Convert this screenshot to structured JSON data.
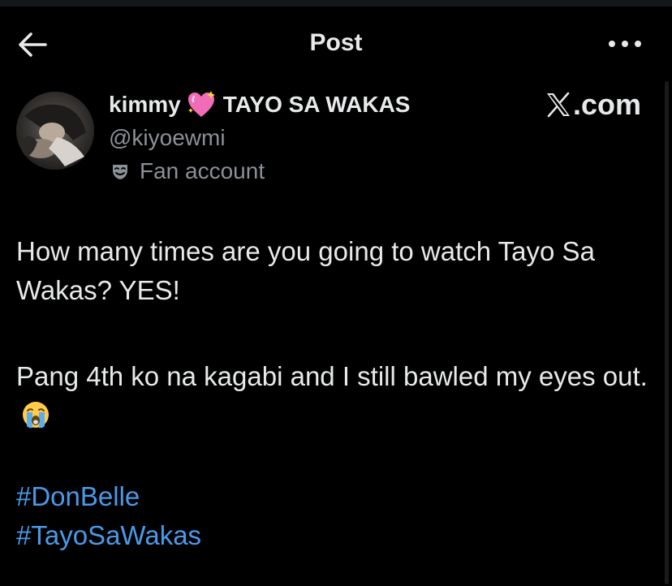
{
  "header": {
    "title": "Post",
    "back_icon": "arrow-left-icon",
    "more_icon": "more-horizontal-icon"
  },
  "author": {
    "name": "kimmy",
    "name_emoji": "sparkling-heart-emoji",
    "name_suffix": "TAYO SA WAKAS",
    "handle": "@kiyoewmi",
    "label": "Fan account",
    "label_icon": "mask-icon"
  },
  "watermark": {
    "text": ".com",
    "logo": "x-logo"
  },
  "post": {
    "line1": "How many times are you going to watch Tayo Sa Wakas? YES!",
    "line2": "Pang 4th ko na kagabi and I still bawled my eyes out.",
    "line2_emoji": "loudly-crying-face-emoji",
    "hashtags": [
      "#DonBelle",
      "#TayoSaWakas"
    ]
  },
  "colors": {
    "background": "#000000",
    "text": "#e7e9ea",
    "secondary_text": "#8b9097",
    "hashtag": "#4a99e9"
  }
}
